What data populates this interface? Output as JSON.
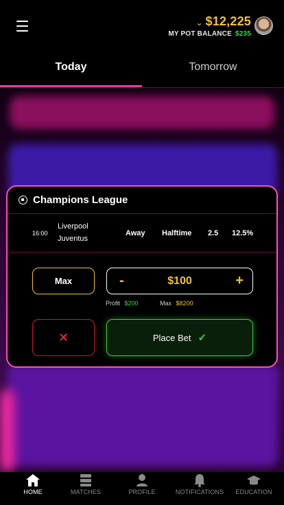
{
  "header": {
    "balance": "$12,225",
    "pot_label": "MY POT BALANCE",
    "pot_amount": "$235"
  },
  "tabs": [
    {
      "label": "Today",
      "active": true
    },
    {
      "label": "Tomorrow",
      "active": false
    }
  ],
  "bet_card": {
    "league": "Champions League",
    "match": {
      "time": "16:00",
      "home_team": "Liverpool",
      "away_team": "Juventus",
      "pick": "Away",
      "period": "Halftime",
      "line": "2.5",
      "percent": "12.5%"
    },
    "max_label": "Max",
    "minus_label": "-",
    "amount": "$100",
    "plus_label": "+",
    "profit_label": "Profit",
    "profit_value": "$200",
    "max_value_label": "Max",
    "max_value": "$8200",
    "cancel_symbol": "✕",
    "place_bet_label": "Place Bet"
  },
  "bottom_nav": [
    {
      "label": "HOME",
      "icon": "home-icon",
      "active": true
    },
    {
      "label": "MATCHES",
      "icon": "matches-icon",
      "active": false
    },
    {
      "label": "PROFILE",
      "icon": "profile-icon",
      "active": false
    },
    {
      "label": "NOTIFICATIONS",
      "icon": "bell-icon",
      "active": false
    },
    {
      "label": "EDUCATION",
      "icon": "graduation-cap-icon",
      "active": false
    }
  ],
  "colors": {
    "accent_pink": "#ff2da6",
    "gold": "#f2c230",
    "green": "#38d54a",
    "red": "#d0182b"
  }
}
